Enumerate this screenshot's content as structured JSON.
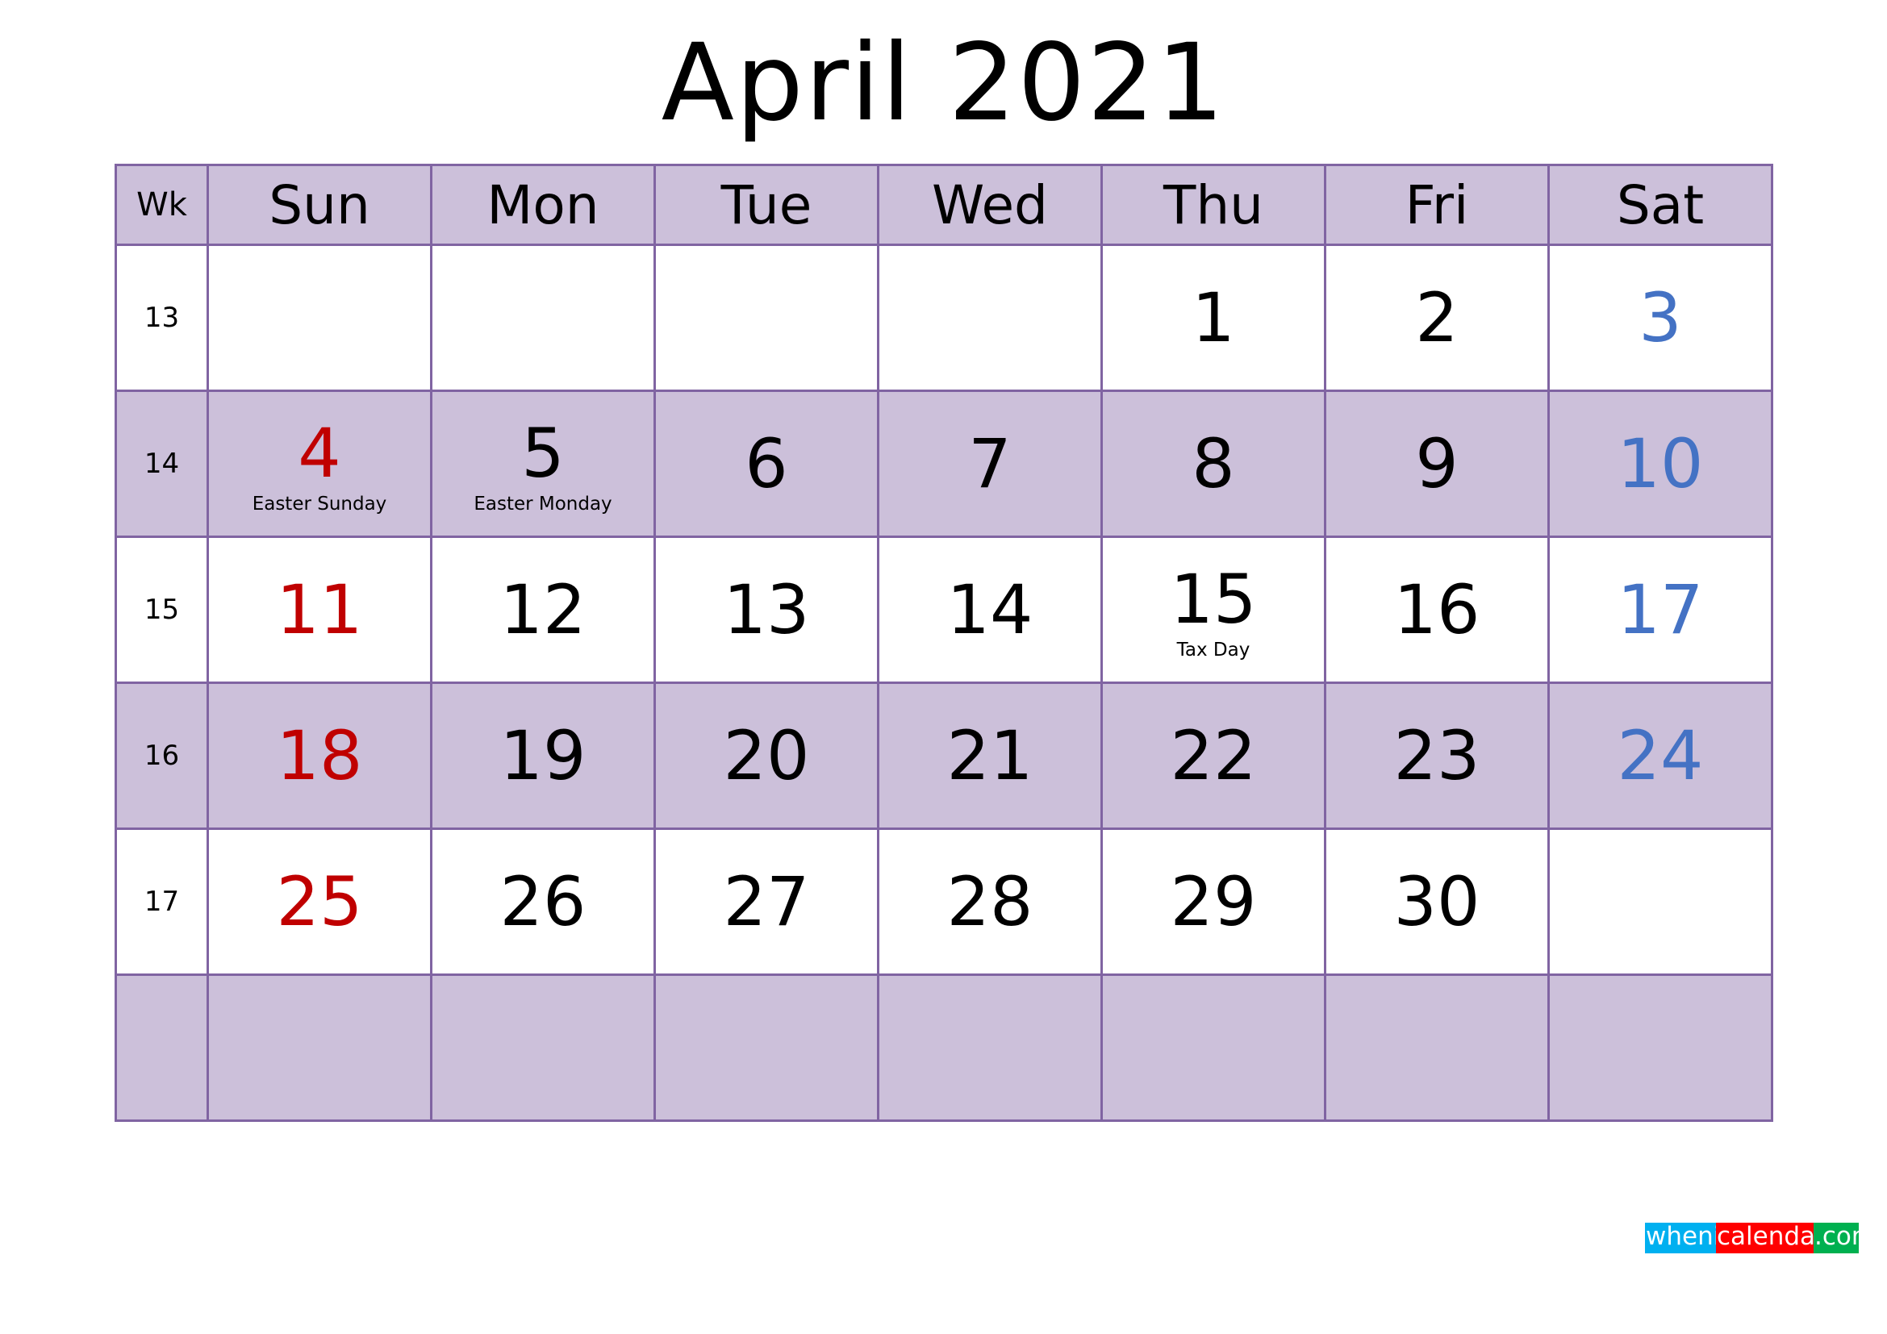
{
  "title": "April 2021",
  "header": {
    "week_label": "Wk",
    "days": [
      "Sun",
      "Mon",
      "Tue",
      "Wed",
      "Thu",
      "Fri",
      "Sat"
    ]
  },
  "weeks": [
    {
      "wk": "13",
      "days": [
        "",
        "",
        "",
        "",
        "1",
        "2",
        "3"
      ],
      "labels": [
        "",
        "",
        "",
        "",
        "",
        "",
        ""
      ]
    },
    {
      "wk": "14",
      "days": [
        "4",
        "5",
        "6",
        "7",
        "8",
        "9",
        "10"
      ],
      "labels": [
        "Easter Sunday",
        "Easter Monday",
        "",
        "",
        "",
        "",
        ""
      ]
    },
    {
      "wk": "15",
      "days": [
        "11",
        "12",
        "13",
        "14",
        "15",
        "16",
        "17"
      ],
      "labels": [
        "",
        "",
        "",
        "",
        "Tax Day",
        "",
        ""
      ]
    },
    {
      "wk": "16",
      "days": [
        "18",
        "19",
        "20",
        "21",
        "22",
        "23",
        "24"
      ],
      "labels": [
        "",
        "",
        "",
        "",
        "",
        "",
        ""
      ]
    },
    {
      "wk": "17",
      "days": [
        "25",
        "26",
        "27",
        "28",
        "29",
        "30",
        ""
      ],
      "labels": [
        "",
        "",
        "",
        "",
        "",
        "",
        ""
      ]
    },
    {
      "wk": "",
      "days": [
        "",
        "",
        "",
        "",
        "",
        "",
        ""
      ],
      "labels": [
        "",
        "",
        "",
        "",
        "",
        "",
        ""
      ]
    }
  ],
  "colors": {
    "border": "#8064a2",
    "shade": "#ccc0da",
    "sunday": "#c00000",
    "saturday": "#4472c4"
  },
  "logo": {
    "part1": "whenis",
    "part2": "calendars",
    "part3": ".com"
  }
}
